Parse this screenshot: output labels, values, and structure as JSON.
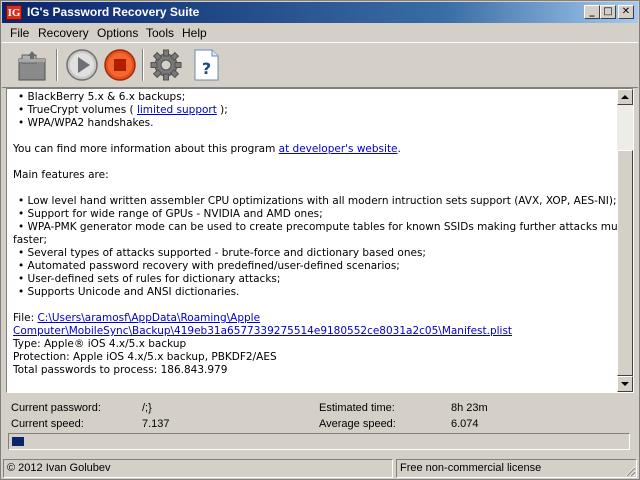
{
  "window": {
    "icon_text": "IG",
    "title": "IG's Password Recovery Suite",
    "minimize_glyph": "_",
    "maximize_glyph": "□",
    "close_glyph": "✕"
  },
  "menu": [
    "File",
    "Recovery",
    "Options",
    "Tools",
    "Help"
  ],
  "toolbar": {
    "icons": [
      "open-icon",
      "start-icon",
      "stop-icon",
      "settings-icon",
      "help-icon"
    ],
    "help_glyph": "?"
  },
  "content": {
    "bullet1": "• BlackBerry 5.x & 6.x backups;",
    "bullet2_pre": "• TrueCrypt volumes ( ",
    "bullet2_link": "limited support",
    "bullet2_post": " );",
    "bullet3": "• WPA/WPA2 handshakes.",
    "more_info_pre": "You can find more information about this program ",
    "more_info_link": "at developer's website",
    "more_info_post": ".",
    "main_features": "Main features are:",
    "features": [
      "• Low level hand written assembler CPU optimizations with all modern intruction sets support (AVX, XOP, AES-NI);",
      "• Support for wide range of GPUs - NVIDIA and AMD ones;",
      "• WPA-PMK generator mode can be used to create precompute tables for known SSIDs making further attacks much",
      "faster;",
      "• Several types of attacks supported - brute-force and dictionary based ones;",
      "• Automated password recovery with predefined/user-defined scenarios;",
      "• User-defined sets of rules for dictionary attacks;",
      "• Supports Unicode and ANSI dictionaries."
    ],
    "file_label": "File: ",
    "file_path_line1": "C:\\Users\\aramosf\\AppData\\Roaming\\Apple",
    "file_path_line2": "Computer\\MobileSync\\Backup\\419eb31a6577339275514e9180552ce8031a2c05\\Manifest.plist",
    "type_line": "Type: Apple® iOS 4.x/5.x backup",
    "protection_line": "Protection: Apple iOS 4.x/5.x backup, PBKDF2/AES",
    "total_line": "Total passwords to process: 186.843.979"
  },
  "stats": {
    "current_password_label": "Current password:",
    "current_password_value": "/;}",
    "current_speed_label": "Current speed:",
    "current_speed_value": "7.137",
    "estimated_time_label": "Estimated time:",
    "estimated_time_value": "8h 23m",
    "average_speed_label": "Average speed:",
    "average_speed_value": "6.074",
    "progress_fraction": 0.01
  },
  "statusbar": {
    "copyright": "© 2012 Ivan Golubev",
    "license": "Free non-commercial license"
  },
  "colors": {
    "titlebar_start": "#0a246a",
    "link": "#0000cc",
    "progress": "#0a246a",
    "stop_button": "#e8501f"
  }
}
